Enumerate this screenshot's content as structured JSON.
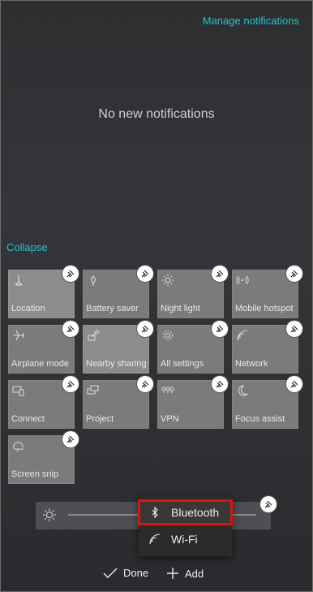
{
  "header": {
    "manage_link": "Manage notifications"
  },
  "notifications": {
    "empty_text": "No new notifications"
  },
  "collapse_link": "Collapse",
  "tiles": [
    {
      "label": "Location",
      "icon": "location-icon"
    },
    {
      "label": "Battery saver",
      "icon": "battery-saver-icon"
    },
    {
      "label": "Night light",
      "icon": "night-light-icon"
    },
    {
      "label": "Mobile hotspot",
      "icon": "mobile-hotspot-icon"
    },
    {
      "label": "Airplane mode",
      "icon": "airplane-icon"
    },
    {
      "label": "Nearby sharing",
      "icon": "nearby-sharing-icon"
    },
    {
      "label": "All settings",
      "icon": "gear-icon"
    },
    {
      "label": "Network",
      "icon": "network-icon"
    },
    {
      "label": "Connect",
      "icon": "connect-icon"
    },
    {
      "label": "Project",
      "icon": "project-icon"
    },
    {
      "label": "VPN",
      "icon": "vpn-icon"
    },
    {
      "label": "Focus assist",
      "icon": "moon-icon"
    },
    {
      "label": "Screen snip",
      "icon": "screen-snip-icon"
    }
  ],
  "add_menu": {
    "items": [
      {
        "label": "Bluetooth",
        "icon": "bluetooth-icon",
        "highlighted": true
      },
      {
        "label": "Wi-Fi",
        "icon": "wifi-icon"
      }
    ]
  },
  "footer": {
    "done_label": "Done",
    "add_label": "Add"
  },
  "colors": {
    "accent": "#1fc3d3",
    "highlight_border": "#d71515"
  }
}
